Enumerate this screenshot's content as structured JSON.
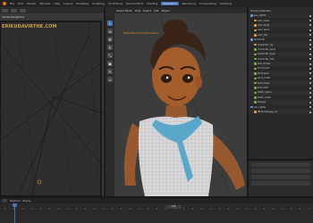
{
  "menu": {
    "items": [
      "File",
      "Edit",
      "Render",
      "Window",
      "Help",
      "Layout",
      "Modeling",
      "Sculpting",
      "UV Editing",
      "Texture Paint",
      "Shading",
      "Animation",
      "Rendering",
      "Compositing",
      "Scripting"
    ],
    "active_index": 11
  },
  "left_view": {
    "watermark": "ERIKUDAVIRTHE.COM",
    "camera_label": "Camera Perspective"
  },
  "center_view": {
    "header_text": "Object Mode",
    "view_menu": "View",
    "select_menu": "Select",
    "add_menu": "Add",
    "object_menu": "Object",
    "hint": "Shift+Ctrl+Alt+F: Face Creases"
  },
  "outliner": {
    "title": "Scene Collection",
    "items": [
      {
        "label": "env_lights",
        "kind": "collection"
      },
      {
        "label": "cam_head",
        "kind": "object"
      },
      {
        "label": "cam_body",
        "kind": "object"
      },
      {
        "label": "cam_hand",
        "kind": "object"
      },
      {
        "label": "cam_full",
        "kind": "object"
      },
      {
        "label": "character",
        "kind": "collection"
      },
      {
        "label": "character_rig",
        "kind": "object"
      },
      {
        "label": "character_body",
        "kind": "mesh"
      },
      {
        "label": "character_eyes",
        "kind": "mesh"
      },
      {
        "label": "character_hair",
        "kind": "mesh"
      },
      {
        "label": "skin_brows",
        "kind": "mesh"
      },
      {
        "label": "shirt_base",
        "kind": "mesh"
      },
      {
        "label": "shirt_bow",
        "kind": "mesh"
      },
      {
        "label": "shirt_collar",
        "kind": "mesh"
      },
      {
        "label": "skirt_base",
        "kind": "mesh"
      },
      {
        "label": "skirt_belt",
        "kind": "mesh"
      },
      {
        "label": "teeth_upper",
        "kind": "mesh"
      },
      {
        "label": "teeth_lower",
        "kind": "mesh"
      },
      {
        "label": "tongue",
        "kind": "mesh"
      },
      {
        "label": "env_lights",
        "kind": "collection"
      },
      {
        "label": "IBLFaceAngle_sm",
        "kind": "object"
      }
    ]
  },
  "timeline": {
    "current_frame": "120",
    "start": "1",
    "end": "250",
    "playback": "Playback",
    "keying": "Keying"
  }
}
